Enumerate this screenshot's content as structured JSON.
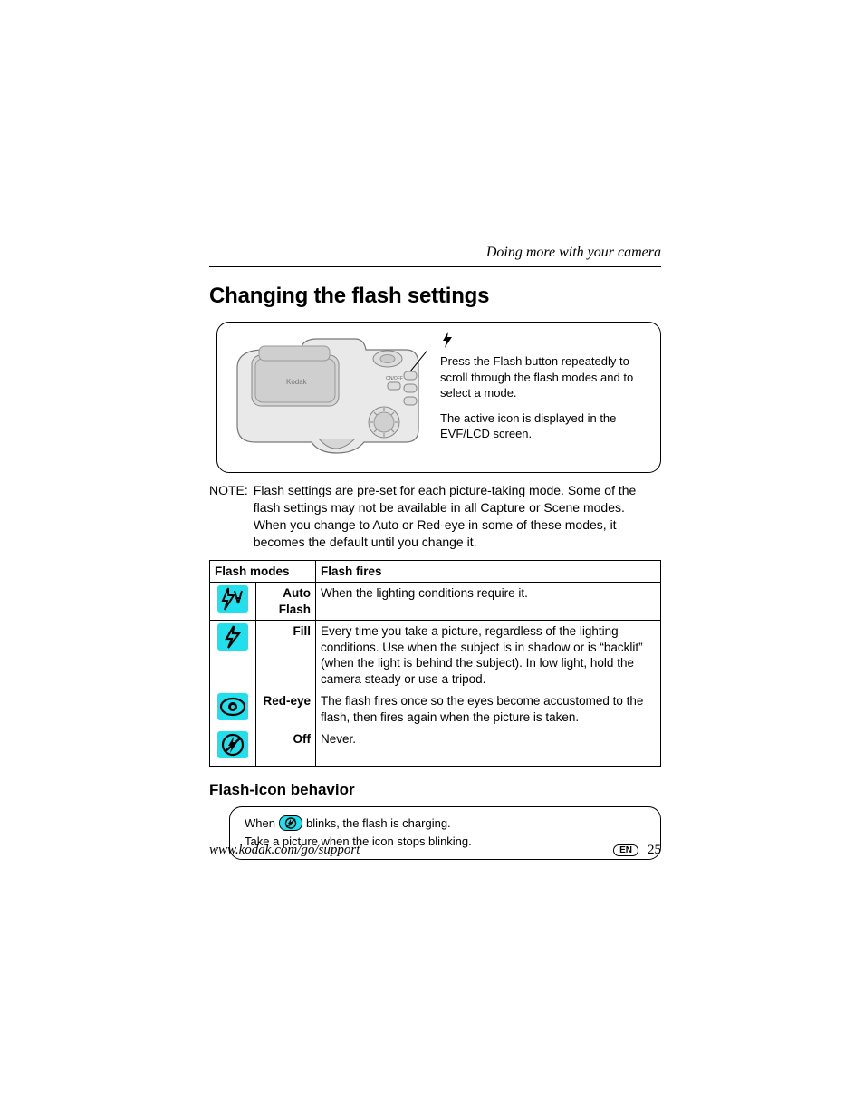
{
  "header": {
    "section": "Doing more with your camera"
  },
  "title": "Changing the flash settings",
  "diagram": {
    "line1": "Press the Flash button repeatedly to scroll through the flash modes and to select a mode.",
    "line2": "The active icon is displayed in the EVF/LCD screen."
  },
  "note": {
    "label": "NOTE:",
    "body": "Flash settings are pre-set for each picture-taking mode. Some of the flash settings may not be available in all Capture or Scene modes. When you change to Auto or Red-eye in some of these modes, it becomes the default until you change it."
  },
  "table": {
    "headers": {
      "modes": "Flash modes",
      "fires": "Flash fires"
    },
    "rows": [
      {
        "icon": "flash-auto",
        "name": "Auto Flash",
        "fires": "When the lighting conditions require it."
      },
      {
        "icon": "flash-fill",
        "name": "Fill",
        "fires": "Every time you take a picture, regardless of the lighting conditions. Use when the subject is in shadow or is “backlit” (when the light is behind the subject). In low light, hold the camera steady or use a tripod."
      },
      {
        "icon": "flash-redeye",
        "name": "Red-eye",
        "fires": "The flash fires once so the eyes become accustomed to the flash, then fires again when the picture is taken."
      },
      {
        "icon": "flash-off",
        "name": "Off",
        "fires": "Never."
      }
    ]
  },
  "subheading": "Flash-icon behavior",
  "behavior": {
    "pre": "When",
    "post": "blinks, the flash is charging.",
    "line2": "Take a picture when the icon stops blinking."
  },
  "footer": {
    "url": "www.kodak.com/go/support",
    "lang": "EN",
    "page": "25"
  }
}
